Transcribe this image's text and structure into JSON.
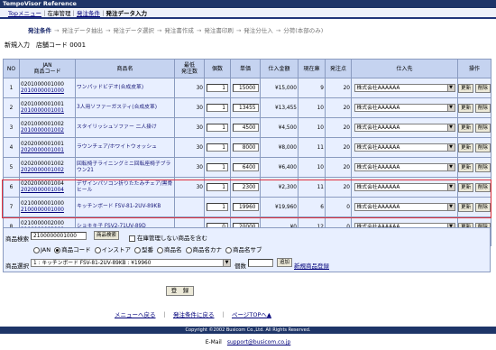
{
  "app_title": "TempoVisor Reference",
  "breadcrumb": {
    "top": "Topメニュー",
    "sep1": "｜",
    "inventory": "在庫管理",
    "sep2": "｜",
    "order_cond": "発注条件",
    "sep3": "｜",
    "current": "発注データ入力"
  },
  "steps": [
    {
      "label": "発注条件",
      "current": true
    },
    {
      "label": "発注データ抽出",
      "current": false
    },
    {
      "label": "発注データ選択",
      "current": false
    },
    {
      "label": "発注書作成",
      "current": false
    },
    {
      "label": "発注書印刷",
      "current": false
    },
    {
      "label": "発注分仕入",
      "current": false
    },
    {
      "label": "分荷(本部のみ)",
      "current": false
    }
  ],
  "step_arrow": "→",
  "subtitle": {
    "mode": "新規入力",
    "store": "店舗コード 0001"
  },
  "table": {
    "headers": {
      "no": "NO",
      "jan_line1": "JAN",
      "jan_line2": "商品コード",
      "name": "商品名",
      "min_line1": "最低",
      "min_line2": "発注数",
      "qty": "個数",
      "unit": "単価",
      "total": "仕入金額",
      "stock": "現在庫",
      "point": "発注点",
      "supplier": "仕入先",
      "ops": "操作"
    },
    "rows": [
      {
        "no": "1",
        "jan": "0201000001000",
        "code": "2010000001000",
        "name": "ワンパッドビデオ(合成皮革)",
        "min": "30",
        "qty": "1",
        "unit": "15000",
        "total": "¥15,000",
        "stock": "9",
        "point": "20",
        "supplier": "株式会社AAAAAA"
      },
      {
        "no": "2",
        "jan": "0201000001001",
        "code": "2010000001001",
        "name": "3人用ソファーガスティ(合成皮革)",
        "min": "30",
        "qty": "1",
        "unit": "13455",
        "total": "¥13,455",
        "stock": "10",
        "point": "20",
        "supplier": "株式会社AAAAAA"
      },
      {
        "no": "3",
        "jan": "0201000001002",
        "code": "2010000001002",
        "name": "スタイリッシュソファー 二人掛け",
        "min": "30",
        "qty": "1",
        "unit": "4500",
        "total": "¥4,500",
        "stock": "10",
        "point": "20",
        "supplier": "株式会社AAAAAA"
      },
      {
        "no": "4",
        "jan": "0202000001001",
        "code": "2020000001001",
        "name": "ラウンチェア/ホワイトウォッシュ",
        "min": "30",
        "qty": "1",
        "unit": "8000",
        "total": "¥8,000",
        "stock": "11",
        "point": "20",
        "supplier": "株式会社AAAAAA"
      },
      {
        "no": "5",
        "jan": "0202000001002",
        "code": "2020000001002",
        "name": "回転椅子ライニングミニ回転座椅子ブラウン21",
        "min": "30",
        "qty": "1",
        "unit": "6400",
        "total": "¥6,400",
        "stock": "10",
        "point": "20",
        "supplier": "株式会社AAAAAA"
      },
      {
        "no": "6",
        "jan": "0202000001004",
        "code": "2020000001004",
        "name": "デザインパソコン折りたたみチェア/黒骨ヒール",
        "min": "30",
        "qty": "1",
        "unit": "2300",
        "total": "¥2,300",
        "stock": "11",
        "point": "20",
        "supplier": "株式会社AAAAAA"
      },
      {
        "no": "7",
        "jan": "0210000001000",
        "code": "2100000001000",
        "name": "キッチンボード FSV-81-2UV-89KB",
        "min": "",
        "qty": "1",
        "unit": "19960",
        "total": "¥19,960",
        "stock": "6",
        "point": "0",
        "supplier": "株式会社AAAAAA"
      },
      {
        "no": "8",
        "jan": "0210000002000",
        "code": "2100000002000",
        "name": "ショキキ子 FSV2-71UV-89D",
        "min": "",
        "qty": "0",
        "unit": "20000",
        "total": "¥0",
        "stock": "12",
        "point": "0",
        "supplier": "株式会社AAAAAA"
      }
    ],
    "sum_label": "合計",
    "sum_qty": "7",
    "sum_total": "¥83,615",
    "update_label": "更新",
    "delete_label": "削除"
  },
  "form": {
    "search_label": "商品検索",
    "search_value": "2100000001000",
    "search_button": "商品検索",
    "checkbox_label": "在庫管理しない商品を含む",
    "radio_options": [
      {
        "label": "JAN",
        "selected": false
      },
      {
        "label": "商品コード",
        "selected": true
      },
      {
        "label": "インストア",
        "selected": false
      },
      {
        "label": "型番",
        "selected": false
      },
      {
        "label": "商品名",
        "selected": false
      },
      {
        "label": "商品名カナ",
        "selected": false
      },
      {
        "label": "商品名サブ",
        "selected": false
      }
    ],
    "select_label": "商品選択",
    "select_value": "1 : キッチンボード FSV-81-2UV-89KB : ¥19960",
    "qty_label": "個数",
    "add_button": "追加",
    "new_link": "新規商品登録"
  },
  "register_button": "登　録",
  "bottom_nav": {
    "menu": "メニューへ戻る",
    "sep1": "｜",
    "order_cond": "発注条件に戻る",
    "sep2": "｜",
    "page_top": "ページTOPへ▲"
  },
  "copyright": "Copyright ©2002 Busicom Co.,Ltd. All Rights Reserved.",
  "email_label": "E-Mail",
  "email": "support@busicom.co.jp"
}
